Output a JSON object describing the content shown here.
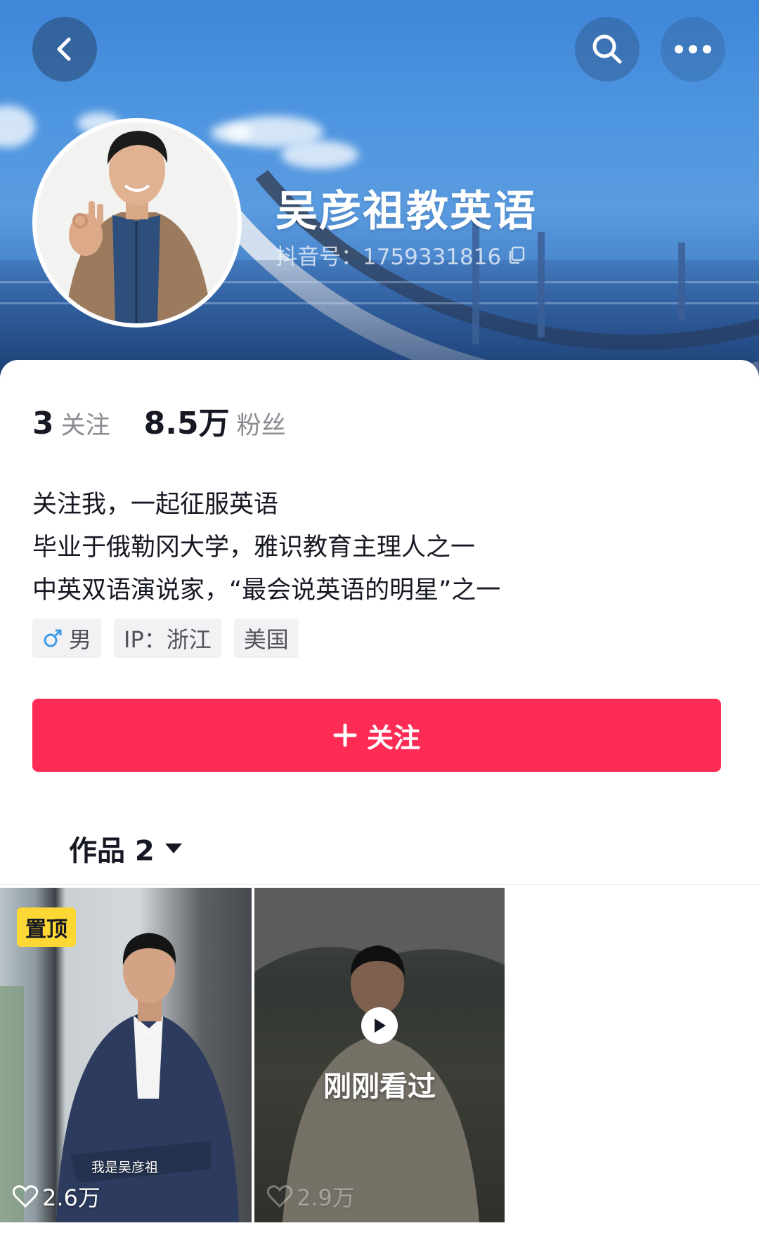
{
  "header": {
    "profile_name": "吴彦祖教英语",
    "douyin_id": "抖音号：1759331816"
  },
  "stats": {
    "following_count": "3",
    "following_label": "关注",
    "followers_count": "8.5万",
    "followers_label": "粉丝"
  },
  "bio": {
    "lines": [
      "关注我，一起征服英语",
      "毕业于俄勒冈大学，雅识教育主理人之一",
      "中英双语演说家，“最会说英语的明星”之一"
    ]
  },
  "tags": {
    "gender": "男",
    "ip": "IP：浙江",
    "country": "美国"
  },
  "follow_button": {
    "plus": "+",
    "label": "关注"
  },
  "works": {
    "tab_label": "作品 2"
  },
  "videos": [
    {
      "badge": "置顶",
      "caption": "我是吴彦祖",
      "likes": "2.6万"
    },
    {
      "overlay": "刚刚看过",
      "likes": "2.9万"
    }
  ],
  "colors": {
    "accent": "#fe2c55",
    "pin_badge": "#fdd733",
    "gender_icon": "#3f9be6"
  },
  "icons": [
    "back-arrow-icon",
    "search-icon",
    "more-icon",
    "copy-icon",
    "male-icon",
    "plus-icon",
    "caret-down-icon",
    "heart-icon",
    "play-icon"
  ]
}
